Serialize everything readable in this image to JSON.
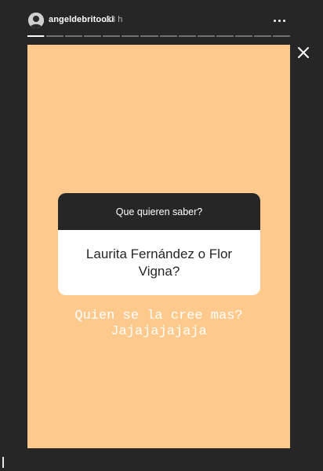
{
  "header": {
    "username": "angeldebritooki",
    "timestamp": "23 h",
    "avatar_icon": "user-avatar",
    "more_icon": "more-horizontal-icon"
  },
  "progress": {
    "segments": 14,
    "current_index": 0,
    "current_fraction": 0.95
  },
  "close_icon": "close-icon",
  "story": {
    "background": "#fec98c",
    "question": {
      "prompt": "Que quieren saber?",
      "answer": "Laurita Fernández o Flor Vigna?"
    },
    "caption_lines": [
      "Quien se la cree mas?",
      "Jajajajajaja"
    ]
  }
}
